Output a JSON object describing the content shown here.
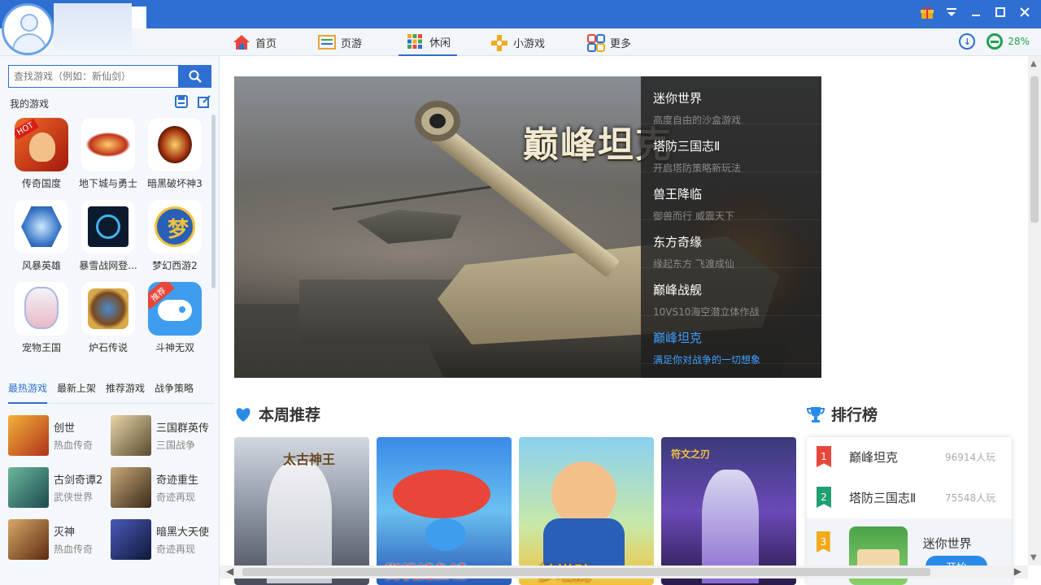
{
  "window": {
    "controls": [
      "gift-icon",
      "menu-icon",
      "minimize-icon",
      "maximize-icon",
      "close-icon"
    ]
  },
  "nav": {
    "tabs": [
      {
        "label": "首页",
        "icon": "home-icon"
      },
      {
        "label": "页游",
        "icon": "webgame-icon"
      },
      {
        "label": "休闲",
        "icon": "casual-icon",
        "active": true
      },
      {
        "label": "小游戏",
        "icon": "minigame-icon"
      },
      {
        "label": "更多",
        "icon": "more-icon"
      }
    ],
    "download_icon": "download-icon",
    "progress_text": "28%",
    "progress_value": 0.28
  },
  "sidebar": {
    "search": {
      "placeholder": "查找游戏（例如：新仙剑）"
    },
    "my_games_title": "我的游戏",
    "my_games": [
      {
        "label": "传奇国度",
        "badge": "HOT",
        "color": "#c8321e"
      },
      {
        "label": "地下城与勇士",
        "color": "#b22a18"
      },
      {
        "label": "暗黑破坏神3",
        "color": "#8a2a10"
      },
      {
        "label": "风暴英雄",
        "color": "#3a78c8"
      },
      {
        "label": "暴雪战网登...",
        "color": "#0c1a2e"
      },
      {
        "label": "梦幻西游2",
        "color": "#2a5fb8"
      },
      {
        "label": "宠物王国",
        "color": "#e9b8c8"
      },
      {
        "label": "炉石传说",
        "color": "#7a4a1e"
      },
      {
        "label": "斗神无双",
        "badge": "推荐",
        "color": "#3f9df0"
      }
    ],
    "category_tabs": [
      "最热游戏",
      "最新上架",
      "推荐游戏",
      "战争策略"
    ],
    "hot_games": [
      {
        "title": "创世",
        "sub": "热血传奇"
      },
      {
        "title": "三国群英传",
        "sub": "三国战争"
      },
      {
        "title": "古剑奇谭2",
        "sub": "武侠世界"
      },
      {
        "title": "奇迹重生",
        "sub": "奇迹再现"
      },
      {
        "title": "灭神",
        "sub": "热血传奇"
      },
      {
        "title": "暗黑大天使",
        "sub": "奇迹再现"
      }
    ]
  },
  "banner": {
    "title": "巅峰坦克",
    "list": [
      {
        "title": "迷你世界",
        "sub": "高度自由的沙盒游戏"
      },
      {
        "title": "塔防三国志Ⅱ",
        "sub": "开启塔防策略新玩法"
      },
      {
        "title": "兽王降临",
        "sub": "御兽而行 威震天下"
      },
      {
        "title": "东方奇缘",
        "sub": "缘起东方 飞渡成仙"
      },
      {
        "title": "巅峰战舰",
        "sub": "10VS10海空潜立体作战"
      },
      {
        "title": "巅峰坦克",
        "sub": "满足你对战争的一切想象",
        "active": true
      }
    ]
  },
  "weekly": {
    "title": "本周推荐",
    "icon": "heart-icon",
    "cards": [
      {
        "name": "game-card-1",
        "text": "太古神王"
      },
      {
        "name": "game-card-2",
        "text": "街机捕鱼城"
      },
      {
        "name": "game-card-3",
        "text": "梦塔防"
      },
      {
        "name": "game-card-4",
        "text": "符文之刃"
      }
    ]
  },
  "ranking": {
    "title": "排行榜",
    "icon": "trophy-icon",
    "items": [
      {
        "rank": "1",
        "name": "巅峰坦克",
        "count": "96914人玩"
      },
      {
        "rank": "2",
        "name": "塔防三国志Ⅱ",
        "count": "75548人玩"
      },
      {
        "rank": "3",
        "name": "迷你世界",
        "button": "开始"
      }
    ]
  }
}
